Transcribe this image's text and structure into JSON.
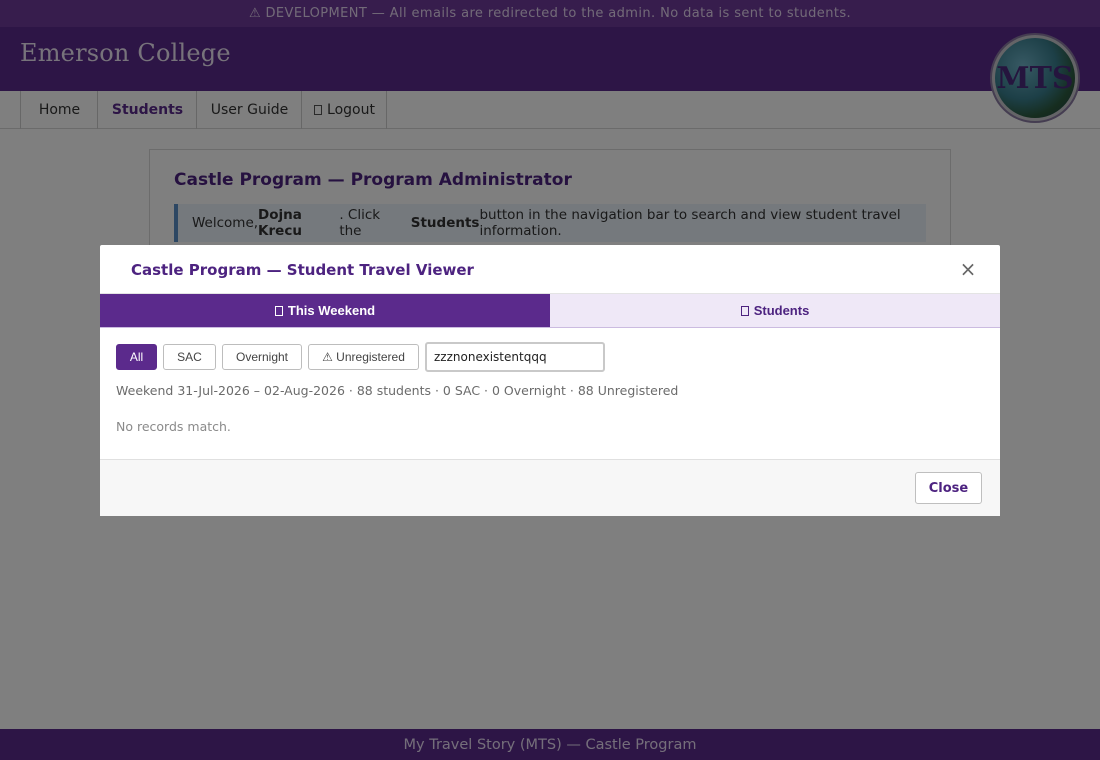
{
  "dev_banner": "⚠ DEVELOPMENT — All emails are redirected to the admin. No data is sent to students.",
  "header": {
    "brand": "Emerson College",
    "logo_text": "MTS"
  },
  "nav": {
    "items": [
      {
        "label": "Home",
        "icon": ""
      },
      {
        "label": "Students",
        "icon": ""
      },
      {
        "label": "User Guide",
        "icon": ""
      },
      {
        "label": "Logout",
        "icon": "logout-icon"
      }
    ],
    "active": "Students"
  },
  "card": {
    "title": "Castle Program — Program Administrator",
    "welcome_prefix": "Welcome, ",
    "welcome_name": "Dojna Krecu",
    "welcome_mid": ". Click the ",
    "welcome_button": "Students",
    "welcome_suffix": " button in the navigation bar to search and view student travel information."
  },
  "modal": {
    "title": "Castle Program — Student Travel Viewer",
    "close_symbol": "×",
    "tabs": [
      {
        "label": "This Weekend",
        "icon": "calendar-icon"
      },
      {
        "label": "Students",
        "icon": "people-icon"
      }
    ],
    "active_tab": "This Weekend",
    "filters": [
      {
        "label": "All"
      },
      {
        "label": "SAC"
      },
      {
        "label": "Overnight"
      },
      {
        "label": "⚠ Unregistered"
      }
    ],
    "active_filter": "All",
    "search_value": "zzznonexistentqqq",
    "summary": "Weekend 31-Jul-2026 – 02-Aug-2026 · 88 students · 0 SAC · 0 Overnight · 88 Unregistered",
    "empty_message": "No records match.",
    "close_button": "Close"
  },
  "footer": "My Travel Story (MTS) — Castle Program",
  "colors": {
    "brand_purple": "#5b2a8c",
    "banner_purple": "#6f3a9a",
    "info_blue": "#5b8fc7"
  }
}
